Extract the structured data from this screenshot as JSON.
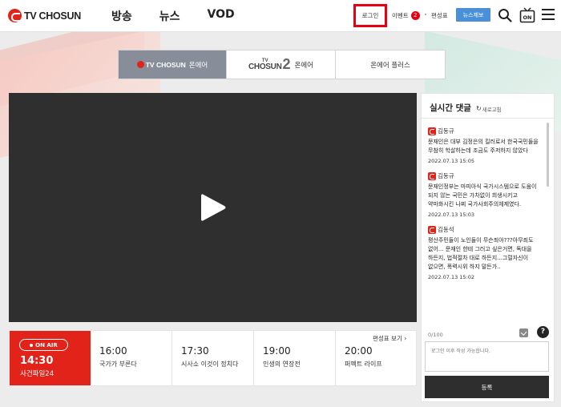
{
  "header": {
    "logo_text": "TV CHOSUN",
    "nav": [
      "방송",
      "뉴스",
      "VOD"
    ],
    "login_label": "로그인",
    "event_label": "이벤트",
    "event_count": "2",
    "schedule_label": "편성표",
    "report_label": "뉴스제보",
    "tv_icon_text": "ON"
  },
  "channel_tabs": {
    "tab1_logo": "TV CHOSUN",
    "tab1_suffix": "온에어",
    "tab2_logo_top": "TV",
    "tab2_logo_main": "CHOSUN",
    "tab2_logo_num": "2",
    "tab2_suffix": "온에어",
    "tab3_label": "온에어 플러스"
  },
  "schedule": {
    "onair_badge": "ON AIR",
    "onair_time": "14:30",
    "onair_title": "사건파일24",
    "more_label": "편성표 보기",
    "slots": [
      {
        "time": "16:00",
        "title": "국가가 부른다"
      },
      {
        "time": "17:30",
        "title": "시사쇼 이것이 정치다"
      },
      {
        "time": "19:00",
        "title": "인생의 연장전"
      },
      {
        "time": "20:00",
        "title": "퍼펙트 라이프"
      }
    ]
  },
  "comments": {
    "title": "실시간 댓글",
    "refresh_label": "새로고침",
    "items": [
      {
        "user": "김동규",
        "text": "문재인은 대부 김정은의 킬러로서 한국국민들을 무참히 학살하는데 조금도 주저하지 않았다",
        "date": "2022.07.13 15:05"
      },
      {
        "user": "김동규",
        "text": "문재인정부는 마피아식 국가시스템으로 도움이 되지 않는 국민은 가차없이 희생시키고 약마화시킨 나찌 국가사회주의체제였다.",
        "date": "2022.07.13 15:03"
      },
      {
        "user": "김동석",
        "text": "평산주민들이 노인들이 무슨죄야???아무죄도 없어... 문재인 한테 그러고 싶은거면, 독대을 하든지, 법적절차 대로 하든지...그럴자신이 없으면, 폭력시위 하지 말든가..",
        "date": "2022.07.13 15:02"
      }
    ],
    "count": "0/100",
    "input_placeholder": "로그인 이후 작성 가능합니다.",
    "submit_label": "등록"
  },
  "colors": {
    "brand_red": "#e2231a",
    "login_highlight": "#e60012",
    "report_blue": "#4a90d9",
    "active_tab": "#878d99"
  }
}
